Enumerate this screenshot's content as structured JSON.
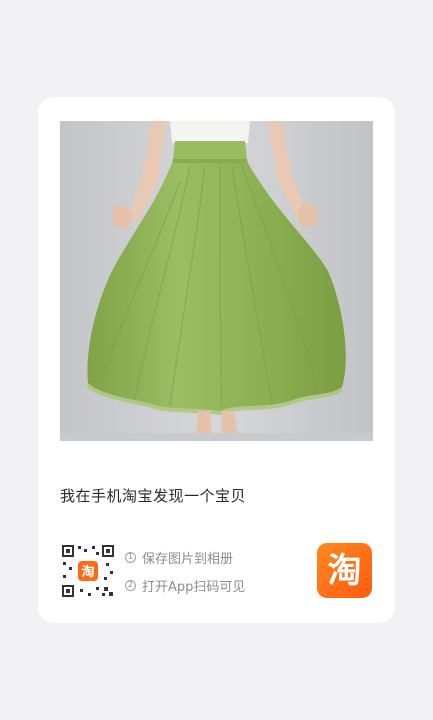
{
  "card": {
    "headline": "我在手机淘宝发现一个宝贝",
    "steps": [
      {
        "number": "1",
        "text": "保存图片到相册"
      },
      {
        "number": "2",
        "text": "打开App扫码可见"
      }
    ],
    "qr_icon": "qr-code-icon",
    "app_logo": {
      "icon": "taobao-logo-icon",
      "text": "淘"
    }
  },
  "colors": {
    "page_background": "#f2f2f4",
    "card_background": "#ffffff",
    "skirt_green": "#8eb155",
    "logo_orange": "#ff6a13"
  }
}
